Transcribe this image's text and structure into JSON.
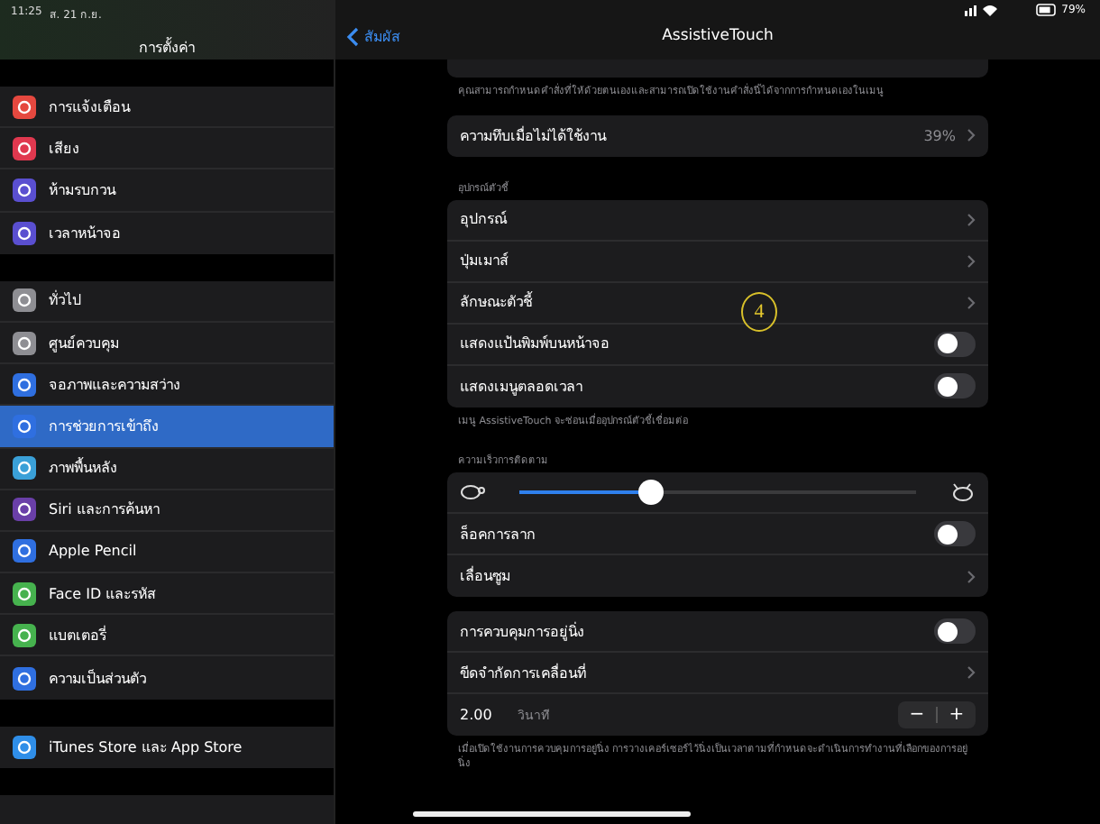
{
  "status_bar": {
    "time": "11:25",
    "date": "ส. 21 ก.ย.",
    "battery": "79%"
  },
  "sidebar": {
    "title": "การตั้งค่า",
    "groups": [
      [
        {
          "label": "การแจ้งเตือน",
          "color": "#e5483f",
          "selected": false
        },
        {
          "label": "เสียง",
          "color": "#e0384f",
          "selected": false
        },
        {
          "label": "ห้ามรบกวน",
          "color": "#5a4fd0",
          "selected": false
        },
        {
          "label": "เวลาหน้าจอ",
          "color": "#5a4fd0",
          "selected": false
        }
      ],
      [
        {
          "label": "ทั่วไป",
          "color": "#8e8e93",
          "selected": false
        },
        {
          "label": "ศูนย์ควบคุม",
          "color": "#8e8e93",
          "selected": false
        },
        {
          "label": "จอภาพและความสว่าง",
          "color": "#2f6fe0",
          "selected": false
        },
        {
          "label": "การช่วยการเข้าถึง",
          "color": "#2f6fe0",
          "selected": true
        },
        {
          "label": "ภาพพื้นหลัง",
          "color": "#3aa0d8",
          "selected": false
        },
        {
          "label": "Siri และการค้นหา",
          "color": "#6a3fa8",
          "selected": false
        },
        {
          "label": "Apple Pencil",
          "color": "#2f6fe0",
          "selected": false
        },
        {
          "label": "Face ID และรหัส",
          "color": "#46b24e",
          "selected": false
        },
        {
          "label": "แบตเตอรี่",
          "color": "#46b24e",
          "selected": false
        },
        {
          "label": "ความเป็นส่วนตัว",
          "color": "#2f6fe0",
          "selected": false
        }
      ],
      [
        {
          "label": "iTunes Store และ App Store",
          "color": "#2f8ee8",
          "selected": false
        }
      ]
    ]
  },
  "detail": {
    "back": "สัมผัส",
    "title": "AssistiveTouch",
    "sections": [
      {
        "footer": "คุณสามารถกำหนดคำสั่งที่ให้ด้วยตนเองและสามารถเปิดใช้งานคำสั่งนี้ได้จากการกำหนดเองในเมนู"
      },
      {
        "rows": [
          {
            "kind": "chevron",
            "label": "ความทึบเมื่อไม่ได้ใช้งาน",
            "value": "39%"
          }
        ]
      },
      {
        "header": "อุปกรณ์ตัวชี้",
        "footer": "เมนู AssistiveTouch จะซ่อนเมื่ออุปกรณ์ตัวชี้เชื่อมต่อ",
        "rows": [
          {
            "kind": "chevron",
            "label": "อุปกรณ์"
          },
          {
            "kind": "chevron",
            "label": "ปุ่มเมาส์"
          },
          {
            "kind": "chevron",
            "label": "ลักษณะตัวชี้"
          },
          {
            "kind": "toggle",
            "label": "แสดงแป้นพิมพ์บนหน้าจอ",
            "on": false
          },
          {
            "kind": "toggle",
            "label": "แสดงเมนูตลอดเวลา",
            "on": false
          }
        ]
      },
      {
        "header": "ความเร็วการติดตาม",
        "rows": [
          {
            "kind": "slider",
            "level": 0.31
          },
          {
            "kind": "toggle",
            "label": "ล็อคการลาก",
            "on": false
          },
          {
            "kind": "chevron",
            "label": "เลื่อนซูม"
          }
        ]
      },
      {
        "footer": "เมื่อเปิดใช้งานการควบคุมการอยู่นิ่ง การวางเคอร์เซอร์ไว้นิ่งเป็นเวลาตามที่กำหนดจะดำเนินการทำงานที่เลือกของการอยู่นิ่ง",
        "rows": [
          {
            "kind": "toggle",
            "label": "การควบคุมการอยู่นิ่ง",
            "on": false
          },
          {
            "kind": "chevron",
            "label": "ขีดจำกัดการเคลื่อนที่"
          },
          {
            "kind": "stepper",
            "value": "2.00",
            "unit": "วินาที",
            "minus": "−",
            "plus": "+"
          }
        ]
      }
    ]
  },
  "annotation": "4"
}
